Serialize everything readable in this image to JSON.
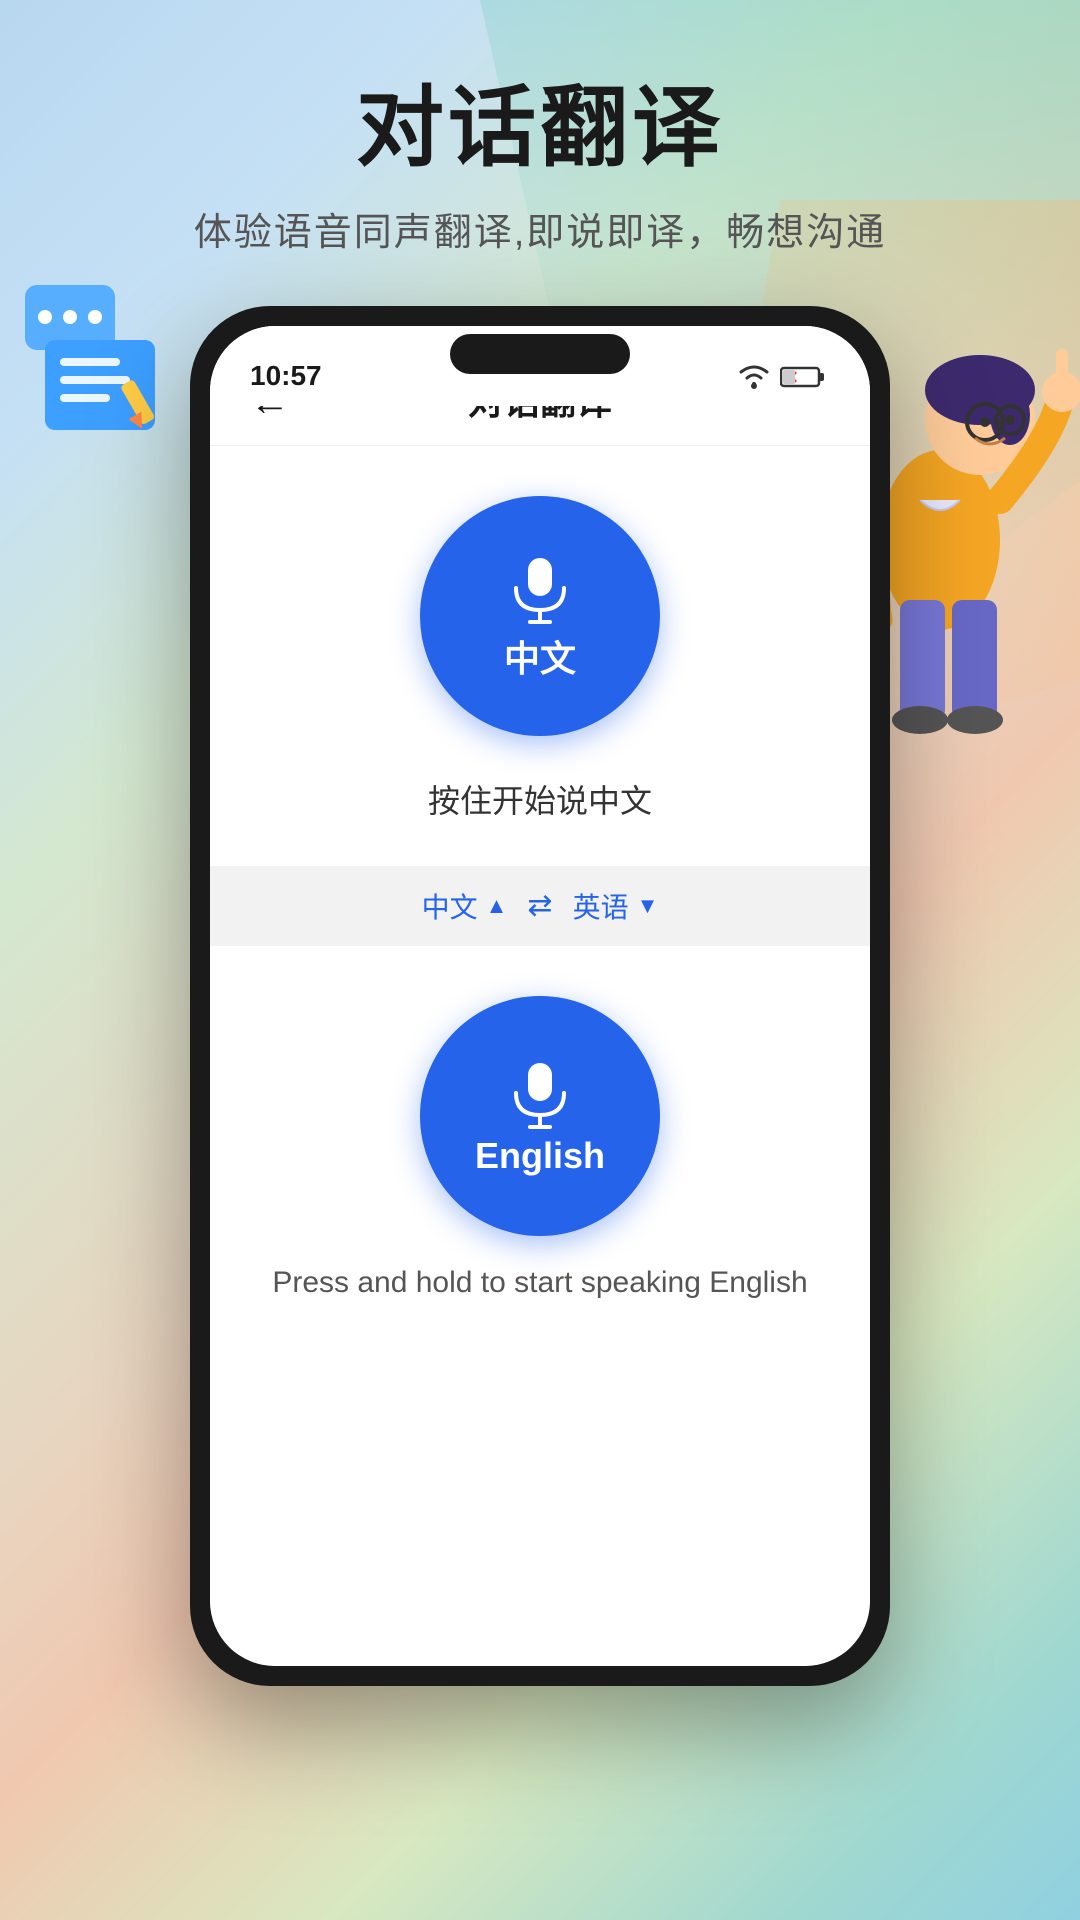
{
  "app": {
    "title": "对话翻译",
    "subtitle": "体验语音同声翻译,即说即译，畅想沟通"
  },
  "phone": {
    "status_time": "10:57",
    "header_title": "对话翻译",
    "back_label": "←"
  },
  "upper_panel": {
    "mic_label": "中文",
    "instruction": "按住开始说中文",
    "mic_icon": "🎙"
  },
  "lang_bar": {
    "left_lang": "中文",
    "left_arrow": "▲",
    "switch": "⇄",
    "right_lang": "英语",
    "right_arrow": "▼"
  },
  "lower_panel": {
    "mic_label": "English",
    "instruction": "Press and hold to start speaking English",
    "mic_icon": "🎙"
  },
  "icons": {
    "back": "←",
    "mic": "🎙"
  }
}
